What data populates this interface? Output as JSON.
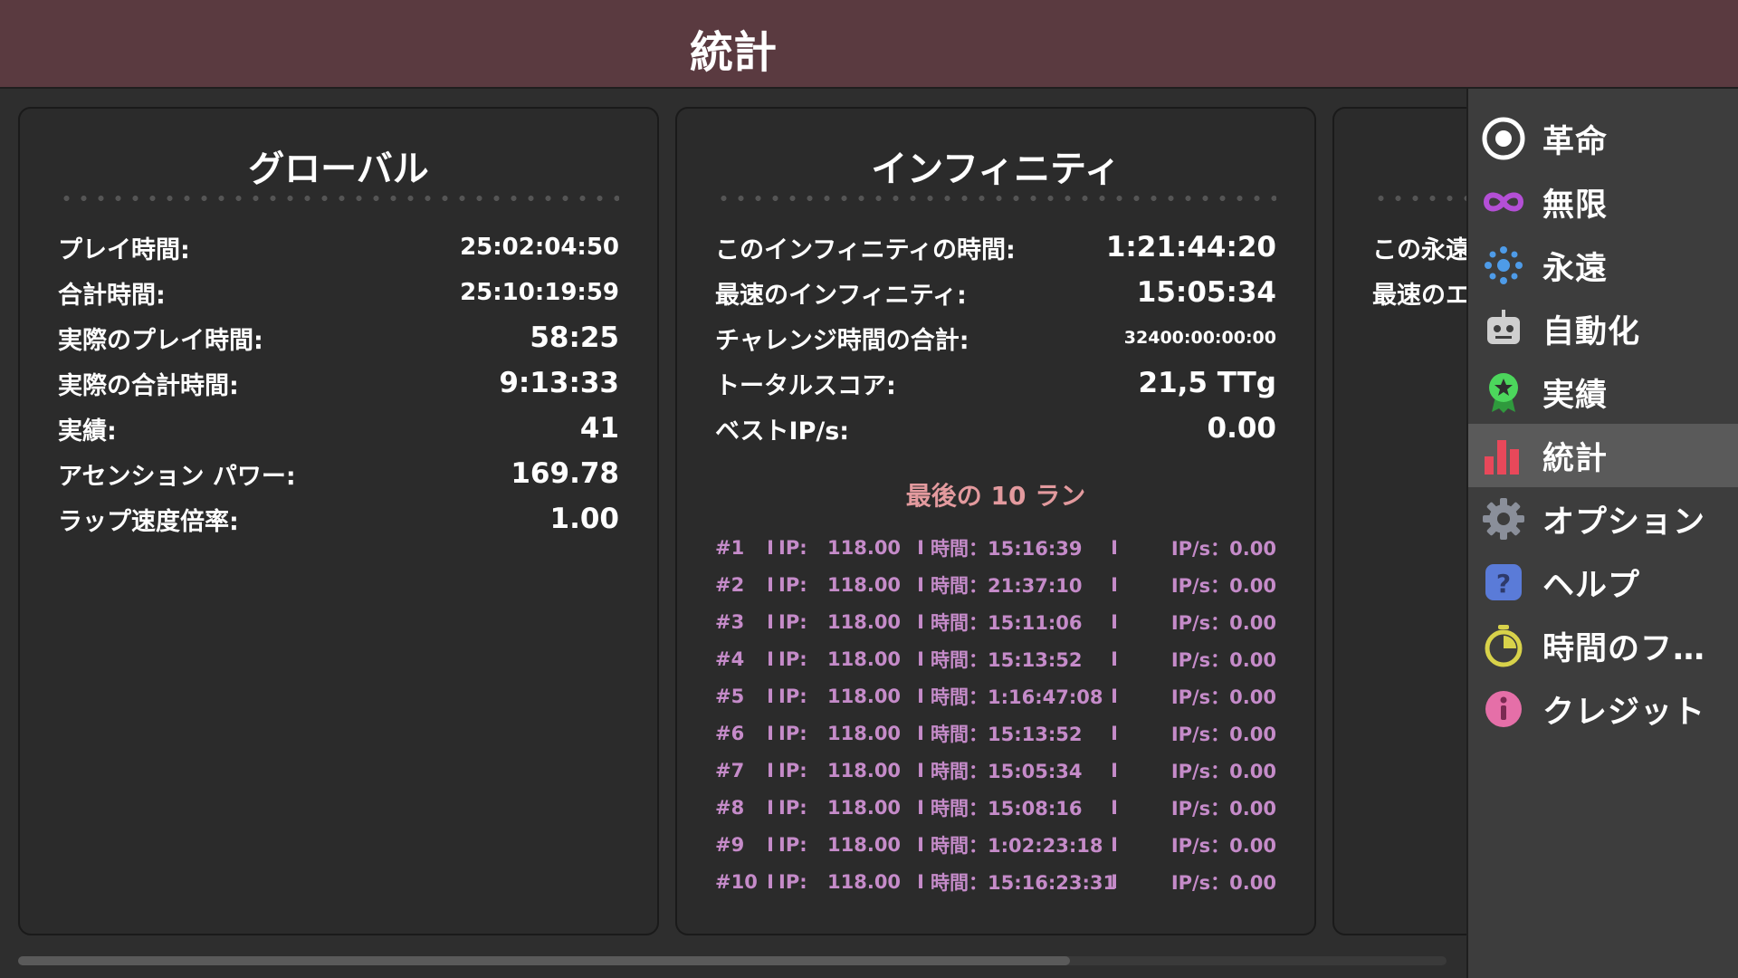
{
  "header": {
    "title": "統計"
  },
  "panels": {
    "global": {
      "title": "グローバル",
      "stats": [
        {
          "label": "プレイ時間:",
          "value": "25:02:04:50"
        },
        {
          "label": "合計時間:",
          "value": "25:10:19:59"
        },
        {
          "label": "実際のプレイ時間:",
          "value": "58:25"
        },
        {
          "label": "実際の合計時間:",
          "value": "9:13:33"
        },
        {
          "label": "実績:",
          "value": "41"
        },
        {
          "label": "アセンション パワー:",
          "value": "169.78"
        },
        {
          "label": "ラップ速度倍率:",
          "value": "1.00"
        }
      ]
    },
    "infinity": {
      "title": "インフィニティ",
      "stats": [
        {
          "label": "このインフィニティの時間:",
          "value": "1:21:44:20"
        },
        {
          "label": "最速のインフィニティ:",
          "value": "15:05:34"
        },
        {
          "label": "チャレンジ時間の合計:",
          "value": "32400:00:00:00"
        },
        {
          "label": "トータルスコア:",
          "value": "21,5 TTg"
        },
        {
          "label": "ベストIP/s:",
          "value": "0.00"
        }
      ],
      "runs_title": "最後の 10 ラン",
      "runs": [
        {
          "num": "#1",
          "ip_label": "IP:",
          "ip": "118.00",
          "time": "時間：15:16:39",
          "ips": "IP/s：0.00"
        },
        {
          "num": "#2",
          "ip_label": "IP:",
          "ip": "118.00",
          "time": "時間：21:37:10",
          "ips": "IP/s：0.00"
        },
        {
          "num": "#3",
          "ip_label": "IP:",
          "ip": "118.00",
          "time": "時間：15:11:06",
          "ips": "IP/s：0.00"
        },
        {
          "num": "#4",
          "ip_label": "IP:",
          "ip": "118.00",
          "time": "時間：15:13:52",
          "ips": "IP/s：0.00"
        },
        {
          "num": "#5",
          "ip_label": "IP:",
          "ip": "118.00",
          "time": "時間：1:16:47:08",
          "ips": "IP/s：0.00"
        },
        {
          "num": "#6",
          "ip_label": "IP:",
          "ip": "118.00",
          "time": "時間：15:13:52",
          "ips": "IP/s：0.00"
        },
        {
          "num": "#7",
          "ip_label": "IP:",
          "ip": "118.00",
          "time": "時間：15:05:34",
          "ips": "IP/s：0.00"
        },
        {
          "num": "#8",
          "ip_label": "IP:",
          "ip": "118.00",
          "time": "時間：15:08:16",
          "ips": "IP/s：0.00"
        },
        {
          "num": "#9",
          "ip_label": "IP:",
          "ip": "118.00",
          "time": "時間：1:02:23:18",
          "ips": "IP/s：0.00"
        },
        {
          "num": "#10",
          "ip_label": "IP:",
          "ip": "118.00",
          "time": "時間：15:16:23:31",
          "ips": "IP/s：0.00"
        }
      ],
      "run_separator": "I"
    },
    "eternity": {
      "stats": [
        {
          "label": "この永遠"
        },
        {
          "label": "最速のエ"
        }
      ]
    }
  },
  "sidebar": {
    "items": [
      {
        "label": "革命",
        "icon": "target-icon"
      },
      {
        "label": "無限",
        "icon": "infinity-icon"
      },
      {
        "label": "永遠",
        "icon": "sparkle-icon"
      },
      {
        "label": "自動化",
        "icon": "robot-icon"
      },
      {
        "label": "実績",
        "icon": "medal-icon"
      },
      {
        "label": "統計",
        "icon": "bar-chart-icon",
        "active": true
      },
      {
        "label": "オプション",
        "icon": "gear-icon"
      },
      {
        "label": "ヘルプ",
        "icon": "help-icon"
      },
      {
        "label": "時間のフ…",
        "icon": "stopwatch-icon"
      },
      {
        "label": "クレジット",
        "icon": "info-icon"
      }
    ]
  },
  "colors": {
    "header_bg": "#5a3a40",
    "runs_title": "#e39a9e",
    "runs_text": "#c58bc9",
    "infinity_icon": "#b44fd6",
    "sparkle_icon": "#4e9be8",
    "medal_icon": "#4cd65c",
    "bar_chart_icon": "#e8485a",
    "stopwatch_icon": "#d8d24a",
    "info_icon": "#e56fa8",
    "help_icon": "#5a7bd8"
  }
}
